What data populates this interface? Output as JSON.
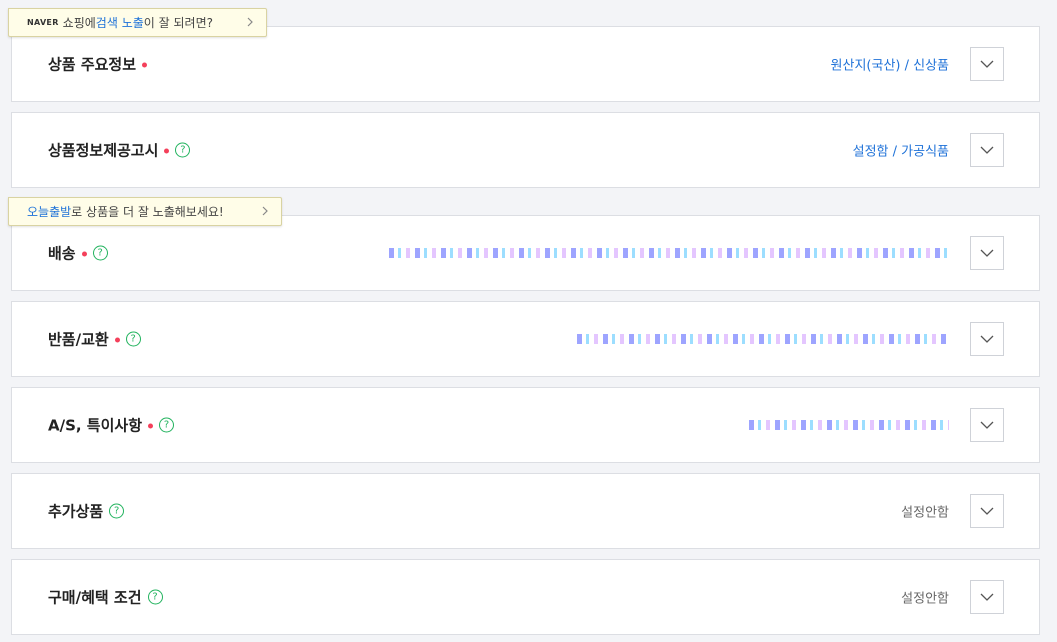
{
  "tooltips": {
    "naver": {
      "brand": "NAVER",
      "text_a": "쇼핑에 ",
      "hl_a": "검색 노출",
      "text_b": "이 잘 되려면?"
    },
    "today": {
      "hl": "오늘출발",
      "text": "로 상품을 더 잘 노출해보세요!"
    }
  },
  "sections": {
    "main_info": {
      "title": "상품 주요정보",
      "summary": "원산지(국산) / 신상품"
    },
    "notice": {
      "title": "상품정보제공고시",
      "summary": "설정함 / 가공식품"
    },
    "delivery": {
      "title": "배송"
    },
    "return": {
      "title": "반품/교환"
    },
    "as": {
      "title": "A/S, 특이사항"
    },
    "addon": {
      "title": "추가상품",
      "summary": "설정안함"
    },
    "purchase": {
      "title": "구매/혜택 조건",
      "summary": "설정안함"
    }
  },
  "icons": {
    "help": "question-icon",
    "toggle": "chevron-down-icon"
  },
  "colors": {
    "accent": "#1f72d8",
    "required": "#f4405b",
    "help": "#22b35e"
  }
}
